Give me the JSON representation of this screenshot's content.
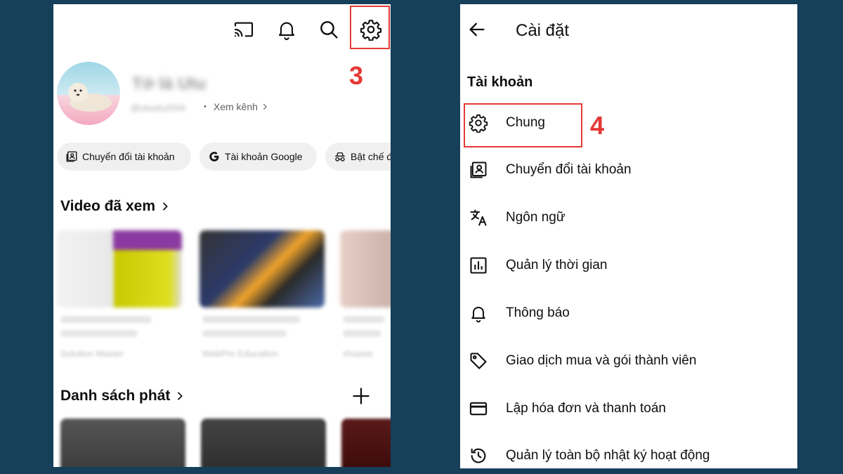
{
  "left": {
    "step_label": "3",
    "profile": {
      "name": "Tớ là Utu",
      "handle": "@utuutu2004",
      "separator": "•",
      "view_channel": "Xem kênh"
    },
    "chips": [
      {
        "label": "Chuyển đổi tài khoản",
        "icon": "switch-account-icon"
      },
      {
        "label": "Tài khoản Google",
        "icon": "google-g-icon"
      },
      {
        "label": "Bật chế độ",
        "icon": "incognito-icon"
      }
    ],
    "history_title": "Video đã xem",
    "history_channels": [
      "Solution Master",
      "WebPro Education",
      "shopee"
    ],
    "playlist_title": "Danh sách phát"
  },
  "right": {
    "title": "Cài đặt",
    "section": "Tài khoản",
    "step_label": "4",
    "items": [
      {
        "label": "Chung",
        "icon": "gear-icon"
      },
      {
        "label": "Chuyển đổi tài khoản",
        "icon": "switch-account-icon"
      },
      {
        "label": "Ngôn ngữ",
        "icon": "translate-icon"
      },
      {
        "label": "Quản lý thời gian",
        "icon": "bar-chart-icon"
      },
      {
        "label": "Thông báo",
        "icon": "bell-icon"
      },
      {
        "label": "Giao dịch mua và gói thành viên",
        "icon": "tag-icon"
      },
      {
        "label": "Lập hóa đơn và thanh toán",
        "icon": "credit-card-icon"
      },
      {
        "label": "Quản lý toàn bộ nhật ký hoạt động",
        "icon": "history-icon"
      }
    ]
  },
  "colors": {
    "background": "#163f5a",
    "highlight": "#e53935",
    "chip_bg": "#f0f0f0"
  }
}
